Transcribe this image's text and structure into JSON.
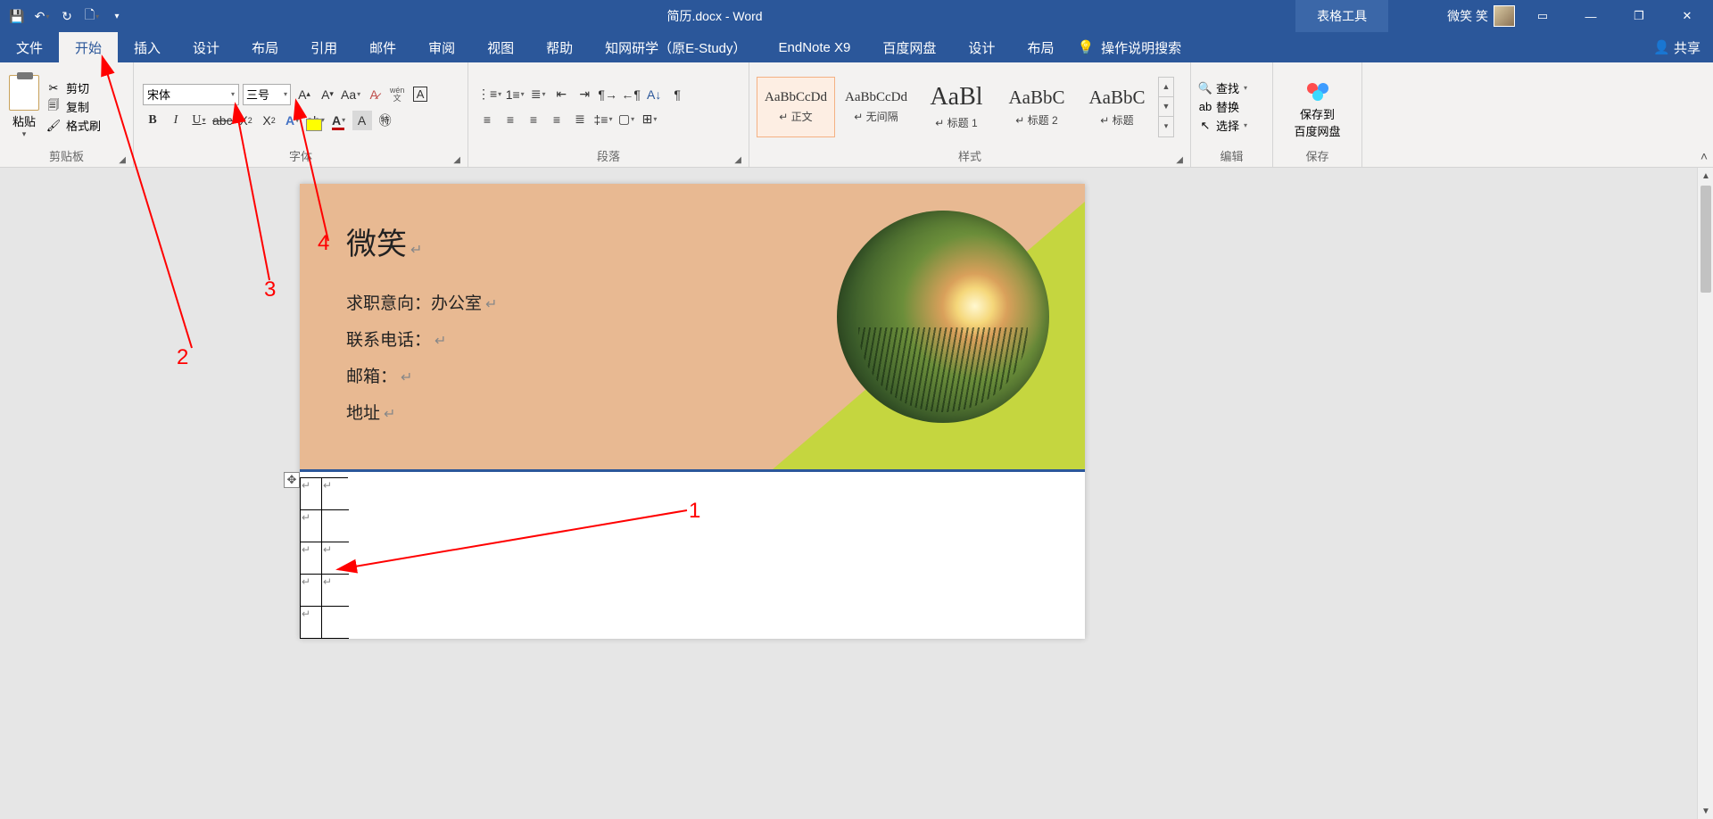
{
  "titlebar": {
    "doc_title": "简历.docx  -  Word",
    "table_tools": "表格工具",
    "username": "微笑 笑"
  },
  "tabs": {
    "file": "文件",
    "home": "开始",
    "insert": "插入",
    "design": "设计",
    "layout": "布局",
    "references": "引用",
    "mailings": "邮件",
    "review": "审阅",
    "view": "视图",
    "help": "帮助",
    "cnki": "知网研学（原E-Study）",
    "endnote": "EndNote X9",
    "baidu": "百度网盘",
    "t_design": "设计",
    "t_layout": "布局",
    "tell_me": "操作说明搜索",
    "share": "共享"
  },
  "clipboard": {
    "paste": "粘贴",
    "cut": "剪切",
    "copy": "复制",
    "painter": "格式刷",
    "label": "剪贴板"
  },
  "font": {
    "name": "宋体",
    "size": "三号",
    "label": "字体"
  },
  "para": {
    "label": "段落"
  },
  "styles": {
    "label": "样式",
    "items": [
      {
        "prev": "AaBbCcDd",
        "name": "正文",
        "sel": true
      },
      {
        "prev": "AaBbCcDd",
        "name": "无间隔"
      },
      {
        "prev": "AaBl",
        "name": "标题 1"
      },
      {
        "prev": "AaBbC",
        "name": "标题 2"
      },
      {
        "prev": "AaBbC",
        "name": "标题"
      }
    ]
  },
  "edit": {
    "find": "查找",
    "replace": "替换",
    "select": "选择",
    "label": "编辑"
  },
  "save": {
    "line1": "保存到",
    "line2": "百度网盘",
    "label": "保存"
  },
  "doc": {
    "name": "微笑",
    "job_label": "求职意向：",
    "job_val": "办公室",
    "phone": "联系电话：",
    "email": "邮箱：",
    "addr": "地址"
  },
  "annotations": {
    "n1": "1",
    "n2": "2",
    "n3": "3",
    "n4": "4"
  }
}
